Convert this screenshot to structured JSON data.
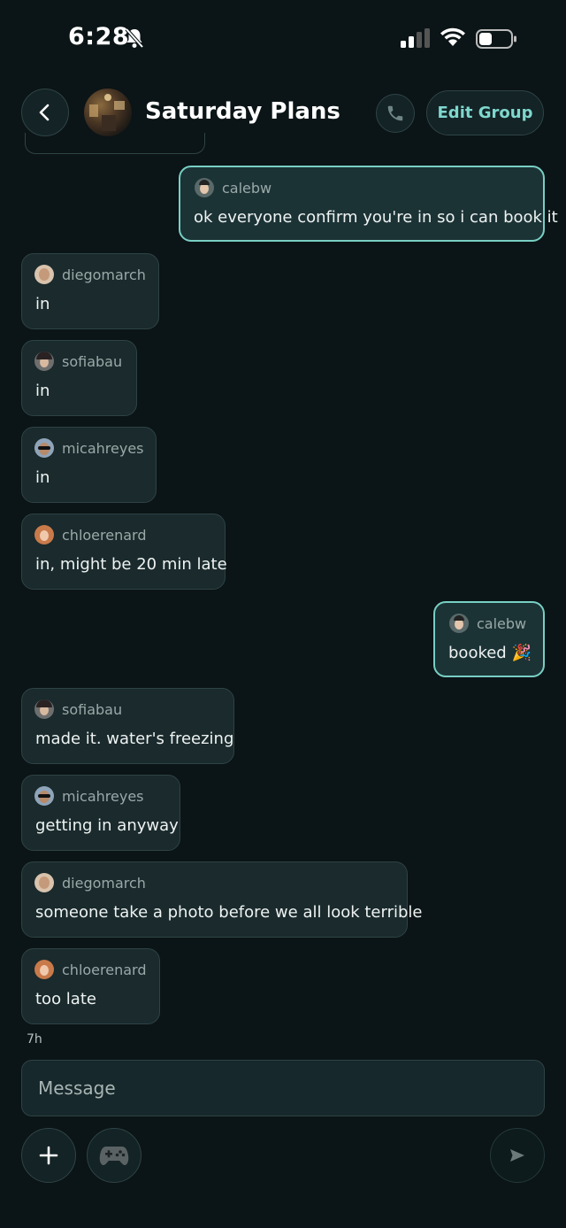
{
  "status": {
    "time": "6:28"
  },
  "header": {
    "title": "Saturday Plans",
    "edit_label": "Edit Group"
  },
  "messages": [
    {
      "sender": "calebw",
      "text": "ok everyone confirm you're in so i can book it",
      "own": true
    },
    {
      "sender": "diegomarch",
      "text": "in",
      "own": false
    },
    {
      "sender": "sofiabau",
      "text": "in",
      "own": false
    },
    {
      "sender": "micahreyes",
      "text": "in",
      "own": false
    },
    {
      "sender": "chloerenard",
      "text": "in, might be 20 min late",
      "own": false
    },
    {
      "sender": "calebw",
      "text": "booked 🎉",
      "own": true
    },
    {
      "sender": "sofiabau",
      "text": "made it. water's freezing",
      "own": false
    },
    {
      "sender": "micahreyes",
      "text": "getting in anyway",
      "own": false
    },
    {
      "sender": "diegomarch",
      "text": "someone take a photo before we all look terrible",
      "own": false
    },
    {
      "sender": "chloerenard",
      "text": "too late",
      "own": false
    }
  ],
  "timestamp": "7h",
  "composer": {
    "placeholder": "Message"
  },
  "icons": {
    "back": "chevron-left-icon",
    "call": "phone-icon",
    "add": "plus-icon",
    "games": "gamepad-icon",
    "send": "send-icon"
  },
  "colors": {
    "accent": "#78cfc4",
    "background": "#0b1416"
  }
}
